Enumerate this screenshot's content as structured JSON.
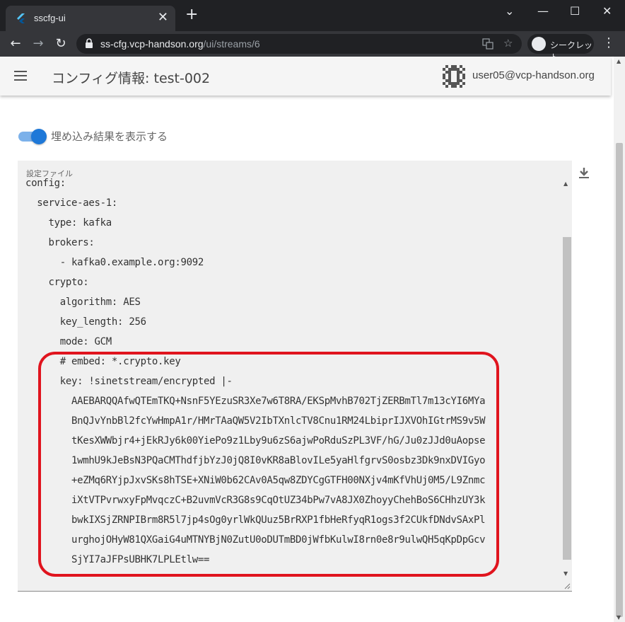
{
  "browser": {
    "tab_title": "sscfg-ui",
    "tab_close": "✕",
    "new_tab": "+",
    "window_controls": {
      "minimize": "—",
      "maximize": "☐",
      "close": "✕",
      "chevron": "⌄"
    },
    "url_host": "ss-cfg.vcp-handson.org",
    "url_path": "/ui/streams/6",
    "incognito_label": "シークレット",
    "nav": {
      "back": "←",
      "forward": "→",
      "reload": "↻"
    },
    "kebab": "⋮",
    "star": "☆"
  },
  "appbar": {
    "title": "コンフィグ情報: test-002",
    "user_email": "user05@vcp-handson.org"
  },
  "toggle": {
    "label": "埋め込み結果を表示する",
    "checked": true,
    "accent_color": "#1e78d8"
  },
  "config_field": {
    "label": "設定ファイル",
    "lines": [
      "config:",
      "  service-aes-1:",
      "    type: kafka",
      "    brokers:",
      "      - kafka0.example.org:9092",
      "    crypto:",
      "      algorithm: AES",
      "      key_length: 256",
      "      mode: GCM",
      "      # embed: *.crypto.key",
      "      key: !sinetstream/encrypted |-",
      "        AAEBARQQAfwQTEmTKQ+NsnF5YEzuSR3Xe7w6T8RA/EKSpMvhB702TjZERBmTl7m13cYI6MYa",
      "        BnQJvYnbBl2fcYwHmpA1r/HMrTAaQW5V2IbTXnlcTV8Cnu1RM24LbiprIJXVOhIGtrMS9v5W",
      "        tKesXWWbjr4+jEkRJy6k00YiePo9z1Lby9u6zS6ajwPoRduSzPL3VF/hG/Ju0zJJd0uAopse",
      "        1wmhU9kJeBsN3PQaCMThdfjbYzJ0jQ8I0vKR8aBlovILe5yaHlfgrvS0osbz3Dk9nxDVIGyo",
      "        +eZMq6RYjpJxvSKs8hTSE+XNiW0b62CAv0A5qw8ZDYCgGTFH00NXjv4mKfVhUj0M5/L9Znmc",
      "        iXtVTPvrwxyFpMvqczC+B2uvmVcR3G8s9CqOtUZ34bPw7vA8JX0ZhoyyChehBoS6CHhzUY3k",
      "        bwkIXSjZRNPIBrm8R5l7jp4sOg0yrlWkQUuz5BrRXP1fbHeRfyqR1ogs3f2CUkfDNdvSAxPl",
      "        urghojOHyW81QXGaiG4uMTNYBjN0ZutU0oDUTmBD0jWfbKulwI8rn0e8r9ulwQH5qKpDpGcv",
      "        SjYI7aJFPsUBHK7LPLEtlw=="
    ],
    "highlight_color": "#e0141e"
  },
  "icons": {
    "tab_favicon": "flutter-icon",
    "lock": "lock-icon",
    "translate": "translate-icon",
    "download": "download-icon",
    "menu": "hamburger-menu-icon",
    "avatar": "pixel-avatar-icon"
  }
}
